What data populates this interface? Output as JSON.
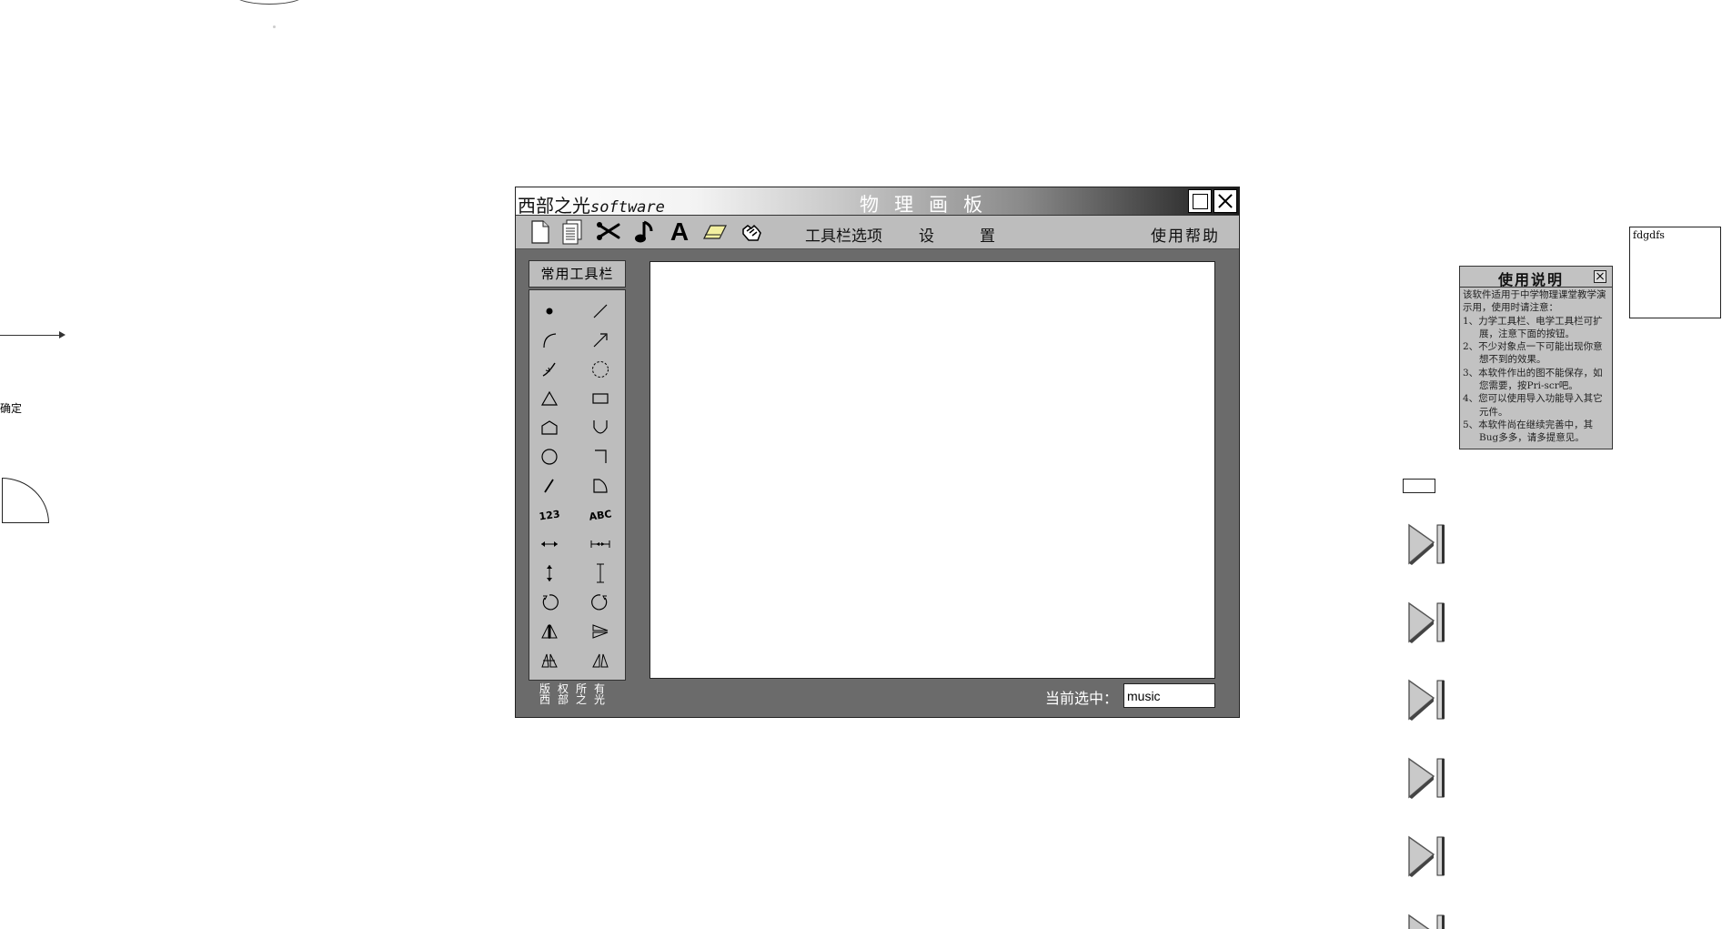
{
  "stray": {
    "confirm_text": "确定"
  },
  "window": {
    "brand_cn": "西部之光",
    "brand_en": "software",
    "title": "物理画板",
    "maximize_icon": "maximize-icon",
    "close_icon": "close-icon"
  },
  "toolbar": {
    "icons": [
      "new-file-icon",
      "copy-doc-icon",
      "scissors-icon",
      "music-note-icon",
      "text-icon",
      "eraser-icon",
      "hand-icon"
    ],
    "text_glyph": "A",
    "toolbar_options": "工具栏选项",
    "settings_1": "设",
    "settings_2": "置",
    "help": "使用帮助"
  },
  "palette": {
    "header": "常用工具栏",
    "number_tool": "123",
    "letter_tool": "ABC",
    "copyright": "版权所有西部之光"
  },
  "status": {
    "label": "当前选中：",
    "value": "music"
  },
  "help_panel": {
    "title": "使用说明",
    "intro": "该软件适用于中学物理课堂教学演示用，使用时请注意：",
    "items": [
      "1、力学工具栏、电学工具栏可扩展，注意下面的按钮。",
      "2、不少对象点一下可能出现你意想不到的效果。",
      "3、本软件作出的图不能保存，如您需要，按Pri-scr吧。",
      "4、您可以使用导入功能导入其它元件。",
      "5、本软件尚在继续完善中，其Bug多多，请多提意见。"
    ]
  },
  "side_box": {
    "text": "fdgdfs"
  },
  "next_buttons": [
    "next-icon",
    "next-icon",
    "next-icon",
    "next-icon",
    "next-icon",
    "next-icon"
  ]
}
